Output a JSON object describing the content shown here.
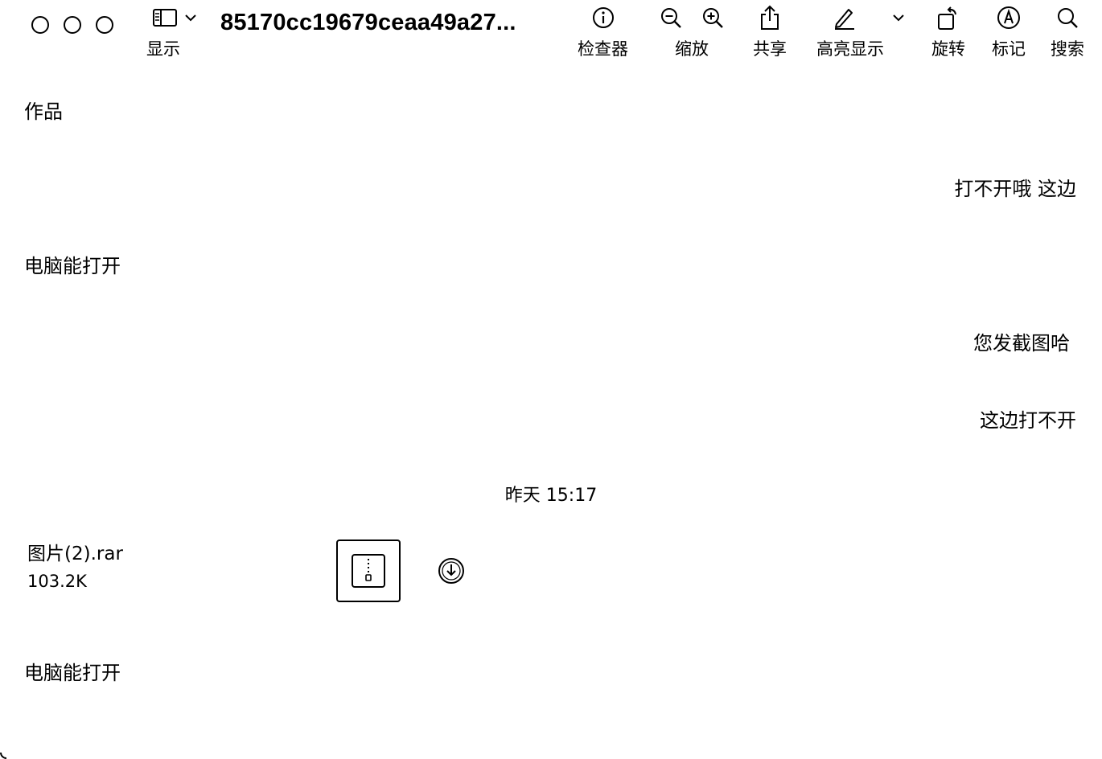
{
  "window": {
    "title": "85170cc19679ceaa49a27..."
  },
  "toolbar": {
    "view_label": "显示",
    "inspector_label": "检查器",
    "zoom_label": "缩放",
    "share_label": "共享",
    "highlight_label": "高亮显示",
    "rotate_label": "旋转",
    "markup_label": "标记",
    "search_label": "搜索",
    "icons": {
      "view": "sidebar-icon",
      "view_menu": "chevron-down-icon",
      "inspector": "info-icon",
      "zoom_out": "zoom-out-icon",
      "zoom_in": "zoom-in-icon",
      "share": "share-icon",
      "highlight": "pen-icon",
      "highlight_menu": "chevron-down-icon",
      "rotate": "rotate-icon",
      "markup": "markup-icon",
      "search": "search-icon"
    }
  },
  "chat": {
    "messages": [
      {
        "side": "left",
        "text": "作品"
      },
      {
        "side": "right",
        "text": "打不开哦  这边"
      },
      {
        "side": "left",
        "text": "电脑能打开"
      },
      {
        "side": "right",
        "text": "您发截图哈"
      },
      {
        "side": "right",
        "text": "这边打不开"
      }
    ],
    "timestamp": "昨天 15:17",
    "file": {
      "name": "图片(2).rar",
      "size": "103.2K",
      "icon": "archive-icon",
      "action_icon": "download-icon"
    },
    "last_message": {
      "side": "left",
      "text": "电脑能打开"
    }
  }
}
